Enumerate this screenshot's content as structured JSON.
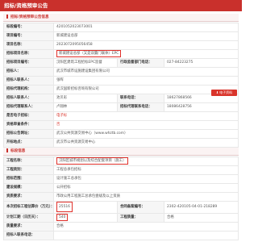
{
  "header": {
    "title": "招标/资格预审公告"
  },
  "section1": {
    "title": "招标/资格预审公告信息",
    "rows": [
      {
        "label": "标段编号：",
        "value": "4201052023073001"
      },
      {
        "label": "项目编号：",
        "value": "新城建设总部"
      },
      {
        "label": "项目名称：",
        "value": "2023072095056458"
      },
      {
        "label": "招标项目名称：",
        "value": "新城建设总部（又是双赢门联体）EPC"
      },
      {
        "label": "招标项目编号：",
        "value": "汉阳区建筑工程招标EPC监督",
        "label2": "行政监督部门电话：",
        "value2": "027-84223275"
      },
      {
        "label": "招标人：",
        "value": "武汉市城市设施建设集团有限公司"
      },
      {
        "label": "招标人联系人：",
        "value": "张晖"
      },
      {
        "label": "招标代理机构：",
        "value": "武汉国新招标咨询有限公司"
      },
      {
        "label": "招标人联系人：",
        "value": "池贝彩",
        "label2": "联系电话：",
        "value2": "18627868566"
      },
      {
        "label": "招标代理联系人：",
        "value": "卢翔林",
        "label2": "招标代理联系电话：",
        "value2": "18086428756"
      },
      {
        "label": "是否电子招标：",
        "value": "电子标"
      },
      {
        "label": "资格审查条件：",
        "value": "否"
      },
      {
        "label": "招标公告网址：",
        "value": "武汉公共资源交易中心（www.whztb.com）"
      },
      {
        "label": "开标地点：",
        "value": "武汉市公共资源交易中心"
      }
    ],
    "download_button": "电子资料"
  },
  "section2": {
    "title": "标段信息",
    "rows": [
      {
        "label": "工程名称：",
        "value": "汉阳区城市规划以及综合配套项目（施工）"
      },
      {
        "label": "工程类别：",
        "value": "工程总承包招标"
      },
      {
        "label": "招标范围：",
        "value": "设计施工总承包"
      },
      {
        "label": "建设规模：",
        "value": "公开招标"
      },
      {
        "label": "资质要求：",
        "value": "市政公用工程施工总承包壹级及以上资质"
      },
      {
        "label": "本次招标工程估算价（万元）：",
        "value": "25516",
        "label2": "合同备案编号：",
        "value2": "2302-420105-04-01-218289",
        "tall": true
      },
      {
        "label": "计划工期（日历天）：",
        "value": "540",
        "label2": "工程质量：",
        "value2": "合格"
      },
      {
        "label": "质量要求：",
        "value": "合格"
      },
      {
        "label": "招标人联系电话：",
        "value": ""
      }
    ]
  }
}
